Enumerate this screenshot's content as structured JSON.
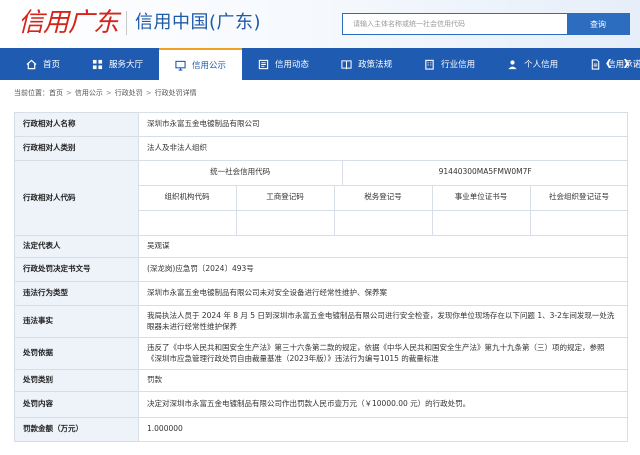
{
  "header": {
    "logo_text": "信用广东",
    "site_title": "信用中国(广东)",
    "search_placeholder": "请输入主体名称或统一社会信用代码",
    "search_button": "查询"
  },
  "nav": {
    "items": [
      {
        "label": "首页",
        "icon": "home-icon",
        "active": false
      },
      {
        "label": "服务大厅",
        "icon": "grid-icon",
        "active": false
      },
      {
        "label": "信用公示",
        "icon": "monitor-icon",
        "active": true
      },
      {
        "label": "信用动态",
        "icon": "news-icon",
        "active": false
      },
      {
        "label": "政策法规",
        "icon": "book-icon",
        "active": false
      },
      {
        "label": "行业信用",
        "icon": "building-icon",
        "active": false
      },
      {
        "label": "个人信用",
        "icon": "person-icon",
        "active": false
      },
      {
        "label": "信用承诺",
        "icon": "document-icon",
        "active": false
      }
    ]
  },
  "breadcrumb": {
    "prefix": "当前位置：",
    "items": [
      "首页",
      "信用公示",
      "行政处罚",
      "行政处罚详情"
    ]
  },
  "detail": {
    "rows": {
      "party_name": {
        "label": "行政相对人名称",
        "value": "深圳市永富五金电镀制品有限公司"
      },
      "party_type": {
        "label": "行政相对人类别",
        "value": "法人及非法人组织"
      },
      "party_code": {
        "label": "行政相对人代码",
        "uscc_label": "统一社会信用代码",
        "uscc_value": "91440300MA5FMW0M7F",
        "sub_labels": [
          "组织机构代码",
          "工商登记码",
          "税务登记号",
          "事业单位证书号",
          "社会组织登记证号"
        ]
      },
      "legal_rep": {
        "label": "法定代表人",
        "value": "吴观谋"
      },
      "doc_no": {
        "label": "行政处罚决定书文号",
        "value": "(深龙岗)应急罚〔2024〕493号"
      },
      "violation_type": {
        "label": "违法行为类型",
        "value": "深圳市永富五金电镀制品有限公司未对安全设备进行经常性维护、保养案"
      },
      "violation_facts": {
        "label": "违法事实",
        "value": "我局执法人员于 2024 年 8 月 5 日到深圳市永富五金电镀制品有限公司进行安全检查，发现你单位现场存在以下问题 1、3-2车间发现一处洗眼器未进行经常性维护保养"
      },
      "penalty_basis": {
        "label": "处罚依据",
        "value": "违反了《中华人民共和国安全生产法》第三十六条第二款的规定，依据《中华人民共和国安全生产法》第九十九条第（三）项的规定，参照《深圳市应急管理行政处罚自由裁量基准（2023年版）》违法行为编号1015 的裁量标准"
      },
      "penalty_category": {
        "label": "处罚类别",
        "value": "罚款"
      },
      "penalty_content": {
        "label": "处罚内容",
        "value": "决定对深圳市永富五金电镀制品有限公司作出罚款人民币壹万元（￥10000.00 元）的行政处罚。"
      },
      "fine_amount": {
        "label": "罚款金额（万元）",
        "value": "1.000000"
      }
    }
  }
}
